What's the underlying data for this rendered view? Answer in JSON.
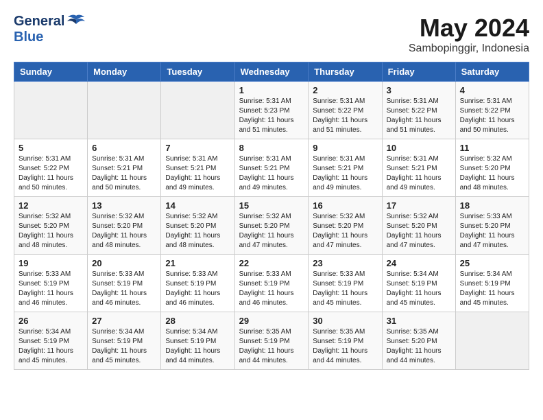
{
  "header": {
    "logo_general": "General",
    "logo_blue": "Blue",
    "month": "May 2024",
    "location": "Sambopinggir, Indonesia"
  },
  "weekdays": [
    "Sunday",
    "Monday",
    "Tuesday",
    "Wednesday",
    "Thursday",
    "Friday",
    "Saturday"
  ],
  "weeks": [
    [
      {
        "day": "",
        "sunrise": "",
        "sunset": "",
        "daylight": ""
      },
      {
        "day": "",
        "sunrise": "",
        "sunset": "",
        "daylight": ""
      },
      {
        "day": "",
        "sunrise": "",
        "sunset": "",
        "daylight": ""
      },
      {
        "day": "1",
        "sunrise": "Sunrise: 5:31 AM",
        "sunset": "Sunset: 5:23 PM",
        "daylight": "Daylight: 11 hours and 51 minutes."
      },
      {
        "day": "2",
        "sunrise": "Sunrise: 5:31 AM",
        "sunset": "Sunset: 5:22 PM",
        "daylight": "Daylight: 11 hours and 51 minutes."
      },
      {
        "day": "3",
        "sunrise": "Sunrise: 5:31 AM",
        "sunset": "Sunset: 5:22 PM",
        "daylight": "Daylight: 11 hours and 51 minutes."
      },
      {
        "day": "4",
        "sunrise": "Sunrise: 5:31 AM",
        "sunset": "Sunset: 5:22 PM",
        "daylight": "Daylight: 11 hours and 50 minutes."
      }
    ],
    [
      {
        "day": "5",
        "sunrise": "Sunrise: 5:31 AM",
        "sunset": "Sunset: 5:22 PM",
        "daylight": "Daylight: 11 hours and 50 minutes."
      },
      {
        "day": "6",
        "sunrise": "Sunrise: 5:31 AM",
        "sunset": "Sunset: 5:21 PM",
        "daylight": "Daylight: 11 hours and 50 minutes."
      },
      {
        "day": "7",
        "sunrise": "Sunrise: 5:31 AM",
        "sunset": "Sunset: 5:21 PM",
        "daylight": "Daylight: 11 hours and 49 minutes."
      },
      {
        "day": "8",
        "sunrise": "Sunrise: 5:31 AM",
        "sunset": "Sunset: 5:21 PM",
        "daylight": "Daylight: 11 hours and 49 minutes."
      },
      {
        "day": "9",
        "sunrise": "Sunrise: 5:31 AM",
        "sunset": "Sunset: 5:21 PM",
        "daylight": "Daylight: 11 hours and 49 minutes."
      },
      {
        "day": "10",
        "sunrise": "Sunrise: 5:31 AM",
        "sunset": "Sunset: 5:21 PM",
        "daylight": "Daylight: 11 hours and 49 minutes."
      },
      {
        "day": "11",
        "sunrise": "Sunrise: 5:32 AM",
        "sunset": "Sunset: 5:20 PM",
        "daylight": "Daylight: 11 hours and 48 minutes."
      }
    ],
    [
      {
        "day": "12",
        "sunrise": "Sunrise: 5:32 AM",
        "sunset": "Sunset: 5:20 PM",
        "daylight": "Daylight: 11 hours and 48 minutes."
      },
      {
        "day": "13",
        "sunrise": "Sunrise: 5:32 AM",
        "sunset": "Sunset: 5:20 PM",
        "daylight": "Daylight: 11 hours and 48 minutes."
      },
      {
        "day": "14",
        "sunrise": "Sunrise: 5:32 AM",
        "sunset": "Sunset: 5:20 PM",
        "daylight": "Daylight: 11 hours and 48 minutes."
      },
      {
        "day": "15",
        "sunrise": "Sunrise: 5:32 AM",
        "sunset": "Sunset: 5:20 PM",
        "daylight": "Daylight: 11 hours and 47 minutes."
      },
      {
        "day": "16",
        "sunrise": "Sunrise: 5:32 AM",
        "sunset": "Sunset: 5:20 PM",
        "daylight": "Daylight: 11 hours and 47 minutes."
      },
      {
        "day": "17",
        "sunrise": "Sunrise: 5:32 AM",
        "sunset": "Sunset: 5:20 PM",
        "daylight": "Daylight: 11 hours and 47 minutes."
      },
      {
        "day": "18",
        "sunrise": "Sunrise: 5:33 AM",
        "sunset": "Sunset: 5:20 PM",
        "daylight": "Daylight: 11 hours and 47 minutes."
      }
    ],
    [
      {
        "day": "19",
        "sunrise": "Sunrise: 5:33 AM",
        "sunset": "Sunset: 5:19 PM",
        "daylight": "Daylight: 11 hours and 46 minutes."
      },
      {
        "day": "20",
        "sunrise": "Sunrise: 5:33 AM",
        "sunset": "Sunset: 5:19 PM",
        "daylight": "Daylight: 11 hours and 46 minutes."
      },
      {
        "day": "21",
        "sunrise": "Sunrise: 5:33 AM",
        "sunset": "Sunset: 5:19 PM",
        "daylight": "Daylight: 11 hours and 46 minutes."
      },
      {
        "day": "22",
        "sunrise": "Sunrise: 5:33 AM",
        "sunset": "Sunset: 5:19 PM",
        "daylight": "Daylight: 11 hours and 46 minutes."
      },
      {
        "day": "23",
        "sunrise": "Sunrise: 5:33 AM",
        "sunset": "Sunset: 5:19 PM",
        "daylight": "Daylight: 11 hours and 45 minutes."
      },
      {
        "day": "24",
        "sunrise": "Sunrise: 5:34 AM",
        "sunset": "Sunset: 5:19 PM",
        "daylight": "Daylight: 11 hours and 45 minutes."
      },
      {
        "day": "25",
        "sunrise": "Sunrise: 5:34 AM",
        "sunset": "Sunset: 5:19 PM",
        "daylight": "Daylight: 11 hours and 45 minutes."
      }
    ],
    [
      {
        "day": "26",
        "sunrise": "Sunrise: 5:34 AM",
        "sunset": "Sunset: 5:19 PM",
        "daylight": "Daylight: 11 hours and 45 minutes."
      },
      {
        "day": "27",
        "sunrise": "Sunrise: 5:34 AM",
        "sunset": "Sunset: 5:19 PM",
        "daylight": "Daylight: 11 hours and 45 minutes."
      },
      {
        "day": "28",
        "sunrise": "Sunrise: 5:34 AM",
        "sunset": "Sunset: 5:19 PM",
        "daylight": "Daylight: 11 hours and 44 minutes."
      },
      {
        "day": "29",
        "sunrise": "Sunrise: 5:35 AM",
        "sunset": "Sunset: 5:19 PM",
        "daylight": "Daylight: 11 hours and 44 minutes."
      },
      {
        "day": "30",
        "sunrise": "Sunrise: 5:35 AM",
        "sunset": "Sunset: 5:19 PM",
        "daylight": "Daylight: 11 hours and 44 minutes."
      },
      {
        "day": "31",
        "sunrise": "Sunrise: 5:35 AM",
        "sunset": "Sunset: 5:20 PM",
        "daylight": "Daylight: 11 hours and 44 minutes."
      },
      {
        "day": "",
        "sunrise": "",
        "sunset": "",
        "daylight": ""
      }
    ]
  ]
}
